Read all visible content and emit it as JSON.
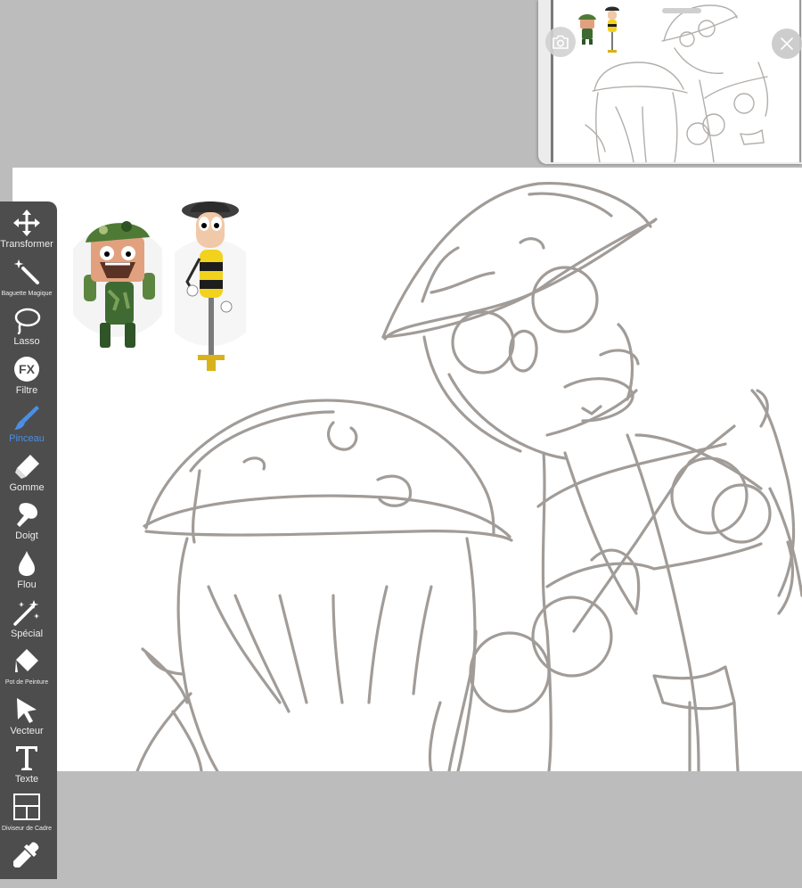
{
  "app": {
    "accent_color": "#4a8fe4",
    "toolbar_color": "#4d4d4d",
    "background_color": "#bcbcbc"
  },
  "toolbar": {
    "tools": [
      {
        "id": "transform",
        "label": "Transformer",
        "icon": "move-arrows-icon",
        "active": false
      },
      {
        "id": "magic-wand",
        "label": "Baguette Magique",
        "icon": "magic-wand-icon",
        "active": false
      },
      {
        "id": "lasso",
        "label": "Lasso",
        "icon": "lasso-icon",
        "active": false
      },
      {
        "id": "filter",
        "label": "Filtre",
        "icon": "fx-icon",
        "active": false
      },
      {
        "id": "brush",
        "label": "Pinceau",
        "icon": "brush-icon",
        "active": true
      },
      {
        "id": "eraser",
        "label": "Gomme",
        "icon": "eraser-icon",
        "active": false
      },
      {
        "id": "smudge",
        "label": "Doigt",
        "icon": "finger-icon",
        "active": false
      },
      {
        "id": "blur",
        "label": "Flou",
        "icon": "drop-icon",
        "active": false
      },
      {
        "id": "special",
        "label": "Spécial",
        "icon": "sparkle-wand-icon",
        "active": false
      },
      {
        "id": "paint-bucket",
        "label": "Pot de Peinture",
        "icon": "paint-bucket-icon",
        "active": false
      },
      {
        "id": "vector",
        "label": "Vecteur",
        "icon": "cursor-arrow-icon",
        "active": false
      },
      {
        "id": "text",
        "label": "Texte",
        "icon": "text-t-icon",
        "active": false
      },
      {
        "id": "frame-divider",
        "label": "Diviseur de Cadre",
        "icon": "frame-divider-icon",
        "active": false
      },
      {
        "id": "eyedropper",
        "label": "",
        "icon": "eyedropper-icon",
        "active": false
      }
    ]
  },
  "preview": {
    "camera_icon": "camera-icon",
    "close_icon": "close-icon"
  },
  "canvas": {
    "stickers": [
      "camo-soldier-character",
      "helmet-pogo-stick-character"
    ]
  }
}
